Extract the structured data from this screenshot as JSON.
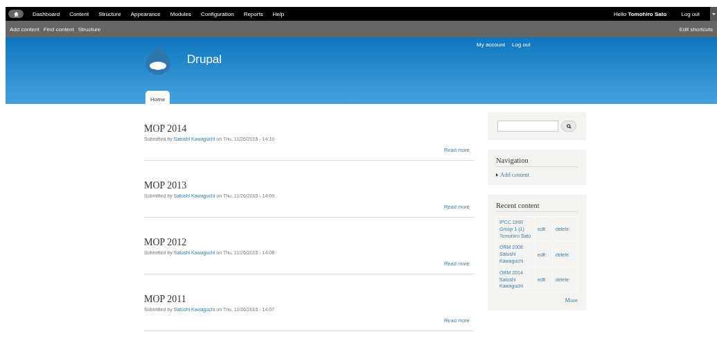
{
  "admin_menu": {
    "items": [
      "Dashboard",
      "Content",
      "Structure",
      "Appearance",
      "Modules",
      "Configuration",
      "Reports",
      "Help"
    ],
    "greeting": "Hello",
    "user": "Tomohiro Sato",
    "logout": "Log out"
  },
  "shortcuts": {
    "items": [
      "Add content",
      "Find content",
      "Structure"
    ],
    "edit": "Edit shortcuts"
  },
  "header": {
    "site_name": "Drupal",
    "secondary_menu": [
      "My account",
      "Log out"
    ],
    "tabs": [
      {
        "label": "Home",
        "selected": true
      }
    ]
  },
  "posts": [
    {
      "title": "MOP 2014",
      "submitted_by": "Submitted by",
      "author": "Satoshi Kawaguchi",
      "date": "on Thu, 11/26/2015 - 14:10",
      "read_more": "Read more"
    },
    {
      "title": "MOP 2013",
      "submitted_by": "Submitted by",
      "author": "Satoshi Kawaguchi",
      "date": "on Thu, 11/26/2015 - 14:09",
      "read_more": "Read more"
    },
    {
      "title": "MOP 2012",
      "submitted_by": "Submitted by",
      "author": "Satoshi Kawaguchi",
      "date": "on Thu, 11/26/2015 - 14:08",
      "read_more": "Read more"
    },
    {
      "title": "MOP 2011",
      "submitted_by": "Submitted by",
      "author": "Satoshi Kawaguchi",
      "date": "on Thu, 11/26/2015 - 14:07",
      "read_more": "Read more"
    }
  ],
  "sidebar": {
    "navigation": {
      "title": "Navigation",
      "items": [
        "Add content"
      ]
    },
    "recent_content": {
      "title": "Recent content",
      "rows": [
        {
          "title": "IPCC 1990 Group 1 (1)",
          "author": "Tomohiro Sato",
          "edit": "edit",
          "delete": "delete"
        },
        {
          "title": "ORM 2008",
          "author": "Satoshi Kawaguchi",
          "edit": "edit",
          "delete": "delete"
        },
        {
          "title": "ORM 2014",
          "author": "Satoshi Kawaguchi",
          "edit": "edit",
          "delete": "delete"
        }
      ],
      "more": "More"
    }
  }
}
